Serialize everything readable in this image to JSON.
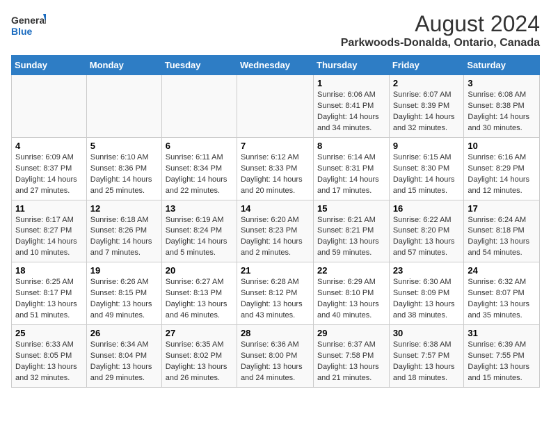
{
  "logo": {
    "line1": "General",
    "line2": "Blue"
  },
  "title": "August 2024",
  "subtitle": "Parkwoods-Donalda, Ontario, Canada",
  "days_of_week": [
    "Sunday",
    "Monday",
    "Tuesday",
    "Wednesday",
    "Thursday",
    "Friday",
    "Saturday"
  ],
  "weeks": [
    [
      {
        "day": "",
        "info": ""
      },
      {
        "day": "",
        "info": ""
      },
      {
        "day": "",
        "info": ""
      },
      {
        "day": "",
        "info": ""
      },
      {
        "day": "1",
        "info": "Sunrise: 6:06 AM\nSunset: 8:41 PM\nDaylight: 14 hours and 34 minutes."
      },
      {
        "day": "2",
        "info": "Sunrise: 6:07 AM\nSunset: 8:39 PM\nDaylight: 14 hours and 32 minutes."
      },
      {
        "day": "3",
        "info": "Sunrise: 6:08 AM\nSunset: 8:38 PM\nDaylight: 14 hours and 30 minutes."
      }
    ],
    [
      {
        "day": "4",
        "info": "Sunrise: 6:09 AM\nSunset: 8:37 PM\nDaylight: 14 hours and 27 minutes."
      },
      {
        "day": "5",
        "info": "Sunrise: 6:10 AM\nSunset: 8:36 PM\nDaylight: 14 hours and 25 minutes."
      },
      {
        "day": "6",
        "info": "Sunrise: 6:11 AM\nSunset: 8:34 PM\nDaylight: 14 hours and 22 minutes."
      },
      {
        "day": "7",
        "info": "Sunrise: 6:12 AM\nSunset: 8:33 PM\nDaylight: 14 hours and 20 minutes."
      },
      {
        "day": "8",
        "info": "Sunrise: 6:14 AM\nSunset: 8:31 PM\nDaylight: 14 hours and 17 minutes."
      },
      {
        "day": "9",
        "info": "Sunrise: 6:15 AM\nSunset: 8:30 PM\nDaylight: 14 hours and 15 minutes."
      },
      {
        "day": "10",
        "info": "Sunrise: 6:16 AM\nSunset: 8:29 PM\nDaylight: 14 hours and 12 minutes."
      }
    ],
    [
      {
        "day": "11",
        "info": "Sunrise: 6:17 AM\nSunset: 8:27 PM\nDaylight: 14 hours and 10 minutes."
      },
      {
        "day": "12",
        "info": "Sunrise: 6:18 AM\nSunset: 8:26 PM\nDaylight: 14 hours and 7 minutes."
      },
      {
        "day": "13",
        "info": "Sunrise: 6:19 AM\nSunset: 8:24 PM\nDaylight: 14 hours and 5 minutes."
      },
      {
        "day": "14",
        "info": "Sunrise: 6:20 AM\nSunset: 8:23 PM\nDaylight: 14 hours and 2 minutes."
      },
      {
        "day": "15",
        "info": "Sunrise: 6:21 AM\nSunset: 8:21 PM\nDaylight: 13 hours and 59 minutes."
      },
      {
        "day": "16",
        "info": "Sunrise: 6:22 AM\nSunset: 8:20 PM\nDaylight: 13 hours and 57 minutes."
      },
      {
        "day": "17",
        "info": "Sunrise: 6:24 AM\nSunset: 8:18 PM\nDaylight: 13 hours and 54 minutes."
      }
    ],
    [
      {
        "day": "18",
        "info": "Sunrise: 6:25 AM\nSunset: 8:17 PM\nDaylight: 13 hours and 51 minutes."
      },
      {
        "day": "19",
        "info": "Sunrise: 6:26 AM\nSunset: 8:15 PM\nDaylight: 13 hours and 49 minutes."
      },
      {
        "day": "20",
        "info": "Sunrise: 6:27 AM\nSunset: 8:13 PM\nDaylight: 13 hours and 46 minutes."
      },
      {
        "day": "21",
        "info": "Sunrise: 6:28 AM\nSunset: 8:12 PM\nDaylight: 13 hours and 43 minutes."
      },
      {
        "day": "22",
        "info": "Sunrise: 6:29 AM\nSunset: 8:10 PM\nDaylight: 13 hours and 40 minutes."
      },
      {
        "day": "23",
        "info": "Sunrise: 6:30 AM\nSunset: 8:09 PM\nDaylight: 13 hours and 38 minutes."
      },
      {
        "day": "24",
        "info": "Sunrise: 6:32 AM\nSunset: 8:07 PM\nDaylight: 13 hours and 35 minutes."
      }
    ],
    [
      {
        "day": "25",
        "info": "Sunrise: 6:33 AM\nSunset: 8:05 PM\nDaylight: 13 hours and 32 minutes."
      },
      {
        "day": "26",
        "info": "Sunrise: 6:34 AM\nSunset: 8:04 PM\nDaylight: 13 hours and 29 minutes."
      },
      {
        "day": "27",
        "info": "Sunrise: 6:35 AM\nSunset: 8:02 PM\nDaylight: 13 hours and 26 minutes."
      },
      {
        "day": "28",
        "info": "Sunrise: 6:36 AM\nSunset: 8:00 PM\nDaylight: 13 hours and 24 minutes."
      },
      {
        "day": "29",
        "info": "Sunrise: 6:37 AM\nSunset: 7:58 PM\nDaylight: 13 hours and 21 minutes."
      },
      {
        "day": "30",
        "info": "Sunrise: 6:38 AM\nSunset: 7:57 PM\nDaylight: 13 hours and 18 minutes."
      },
      {
        "day": "31",
        "info": "Sunrise: 6:39 AM\nSunset: 7:55 PM\nDaylight: 13 hours and 15 minutes."
      }
    ]
  ]
}
